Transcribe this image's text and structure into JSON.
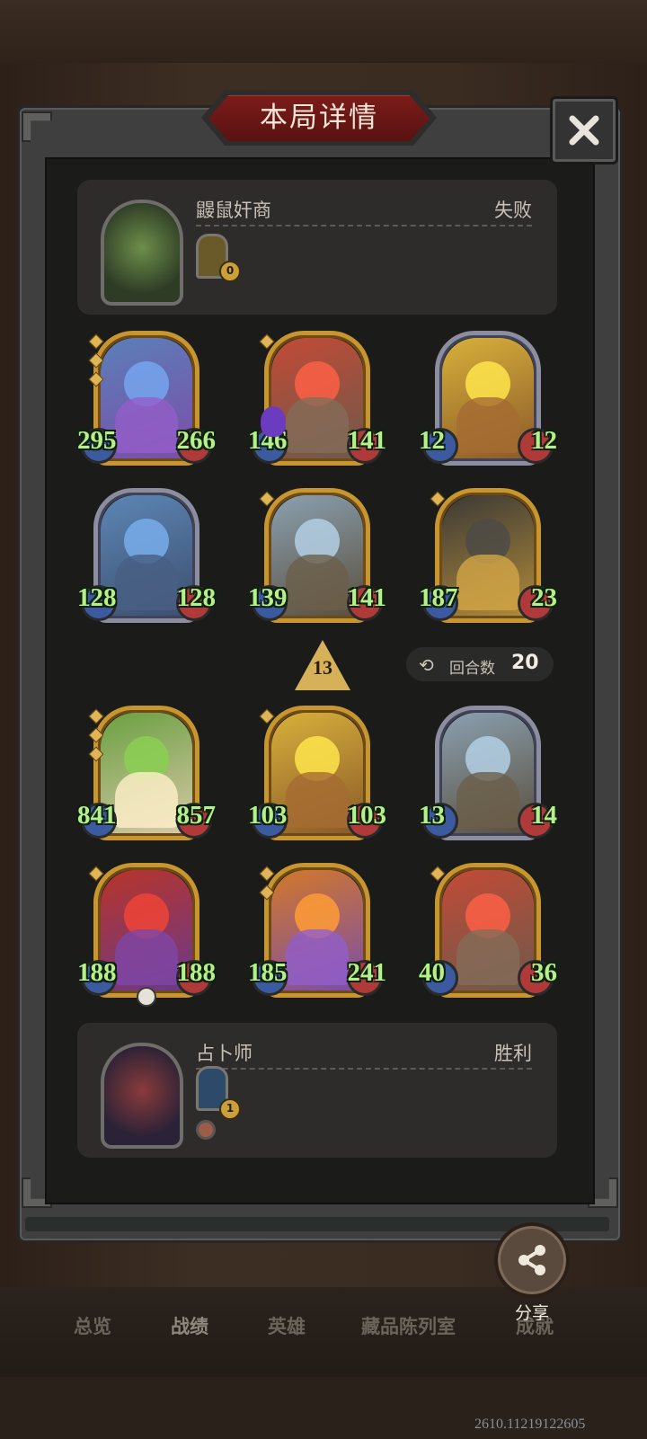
{
  "dialog": {
    "title": "本局详情",
    "close_icon": "close-icon"
  },
  "opponent": {
    "name": "鼹鼠奸商",
    "result": "失败",
    "relic_count": "0"
  },
  "player": {
    "name": "占卜师",
    "result": "胜利",
    "relic_count": "1"
  },
  "opponent_units": [
    {
      "attack": "295",
      "health": "266",
      "frame": "gold",
      "stars": 3,
      "art": [
        "#5b7fb8",
        "#7b4ea8"
      ]
    },
    {
      "attack": "146",
      "health": "141",
      "frame": "gold",
      "stars": 1,
      "art": [
        "#c24a36",
        "#6e5a4a"
      ]
    },
    {
      "attack": "12",
      "health": "12",
      "frame": "silver",
      "stars": 0,
      "art": [
        "#d7b03a",
        "#8a5a2a"
      ]
    },
    {
      "attack": "128",
      "health": "128",
      "frame": "silver",
      "stars": 0,
      "art": [
        "#5c86b5",
        "#3d4f6e"
      ]
    },
    {
      "attack": "139",
      "health": "141",
      "frame": "gold",
      "stars": 1,
      "art": [
        "#8aa0b0",
        "#5a4f3e"
      ]
    },
    {
      "attack": "187",
      "health": "23",
      "frame": "gold",
      "stars": 1,
      "art": [
        "#3c3a36",
        "#b08a3a"
      ]
    }
  ],
  "player_units": [
    {
      "attack": "841",
      "health": "857",
      "frame": "gold",
      "stars": 3,
      "art": [
        "#6aa040",
        "#d8c8a8"
      ]
    },
    {
      "attack": "103",
      "health": "103",
      "frame": "gold",
      "stars": 1,
      "art": [
        "#d7b03a",
        "#8a5a2a"
      ]
    },
    {
      "attack": "13",
      "health": "14",
      "frame": "silver",
      "stars": 0,
      "art": [
        "#8aa0b0",
        "#5a4f3e"
      ]
    },
    {
      "attack": "188",
      "health": "188",
      "frame": "gold",
      "stars": 1,
      "art": [
        "#b8342a",
        "#6a3a8a"
      ]
    },
    {
      "attack": "185",
      "health": "241",
      "frame": "gold",
      "stars": 2,
      "art": [
        "#d2782a",
        "#7a4ea8"
      ]
    },
    {
      "attack": "40",
      "health": "36",
      "frame": "gold",
      "stars": 1,
      "art": [
        "#c24a36",
        "#6e5a4a"
      ]
    }
  ],
  "level": "13",
  "rounds": {
    "label": "回合数",
    "value": "20"
  },
  "share": {
    "label": "分享"
  },
  "tabs": [
    {
      "label": "总览",
      "active": false
    },
    {
      "label": "战绩",
      "active": true
    },
    {
      "label": "英雄",
      "active": false
    },
    {
      "label": "藏品陈列室",
      "active": false
    },
    {
      "label": "成就",
      "active": false
    }
  ],
  "watermark": "2610.11219122605"
}
